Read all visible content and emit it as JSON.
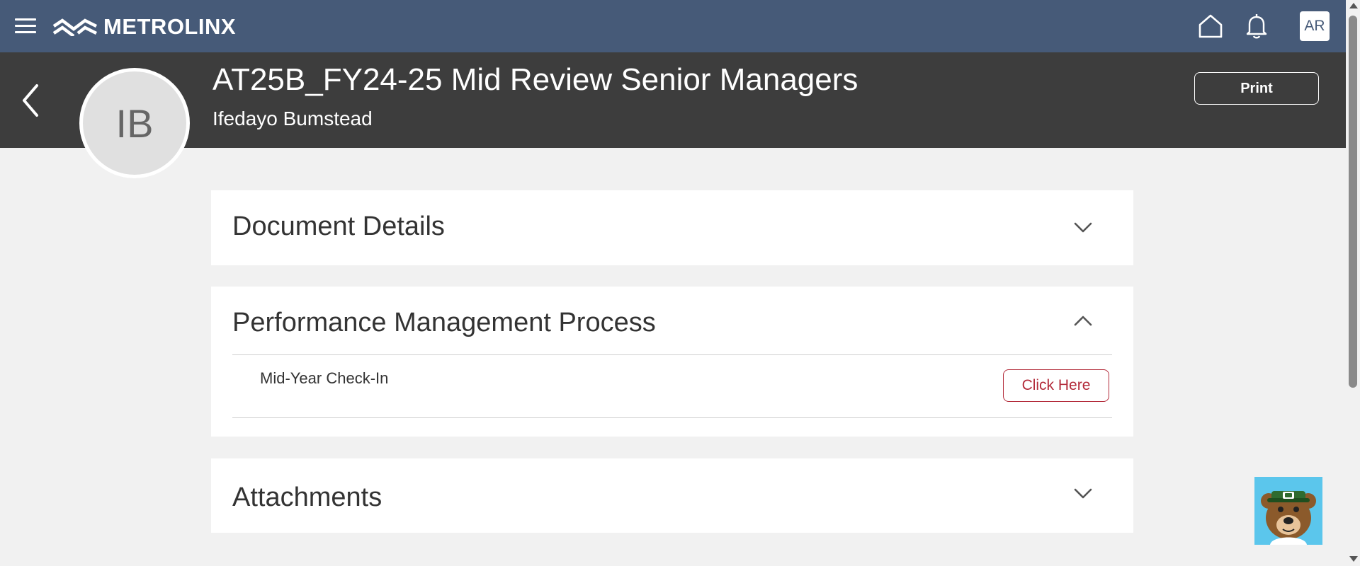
{
  "app": {
    "brand": "METROLINX",
    "user_initials": "AR"
  },
  "header": {
    "title": "AT25B_FY24-25 Mid Review Senior Managers",
    "person_name": "Ifedayo Bumstead",
    "person_initials": "IB",
    "print_label": "Print"
  },
  "sections": {
    "document_details": {
      "title": "Document Details",
      "expanded": false
    },
    "performance": {
      "title": "Performance Management Process",
      "expanded": true,
      "rows": [
        {
          "label": "Mid-Year Check-In",
          "action_label": "Click Here"
        }
      ]
    },
    "attachments": {
      "title": "Attachments",
      "expanded": false
    }
  },
  "icons": {
    "menu": "hamburger-icon",
    "home": "home-icon",
    "notifications": "bell-icon",
    "back": "chevron-left-icon",
    "collapsed": "chevron-down-icon",
    "expanded": "chevron-up-icon",
    "assistant": "bear-mascot-icon"
  },
  "colors": {
    "topbar": "#465a78",
    "header": "#3d3d3d",
    "background": "#f1f1f1",
    "accent_red": "#b32b3a"
  }
}
